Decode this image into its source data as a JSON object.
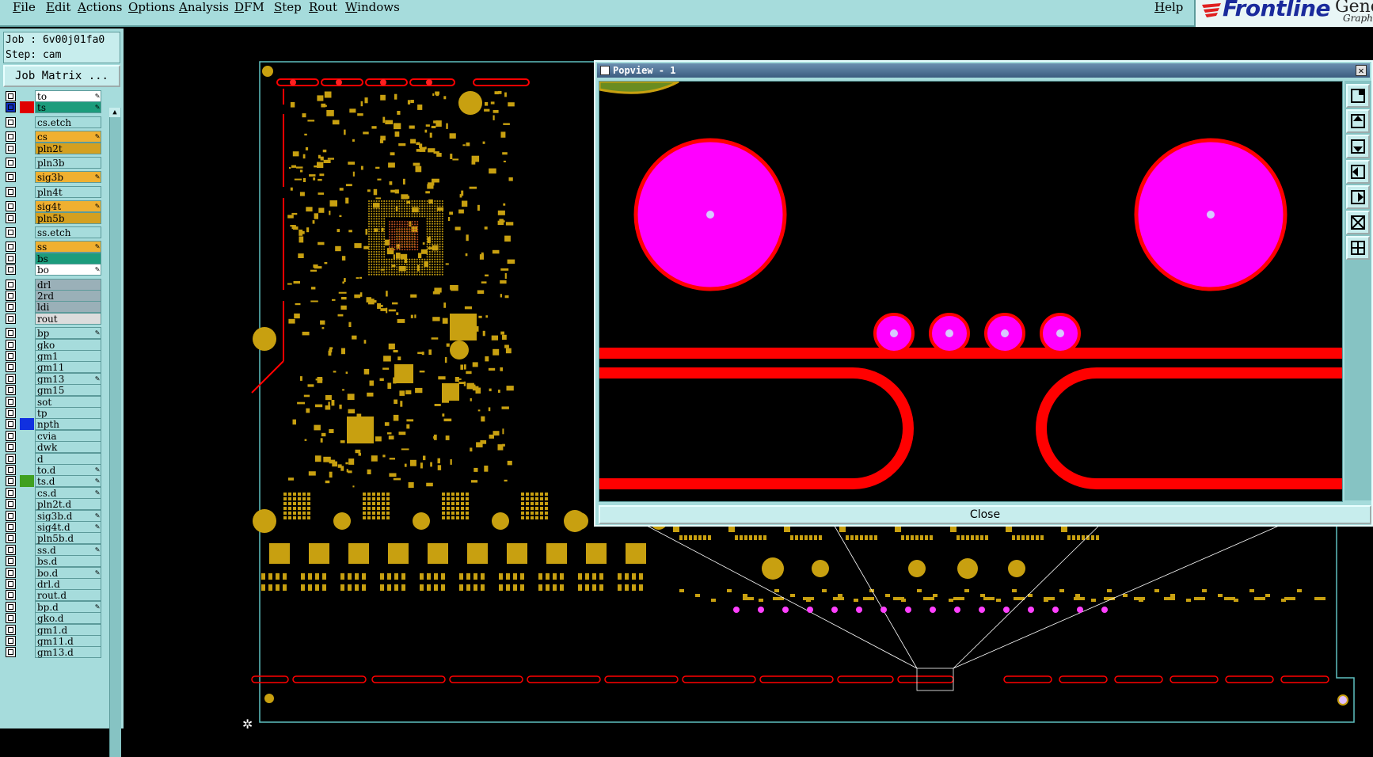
{
  "menubar": {
    "items": [
      "File",
      "Edit",
      "Actions",
      "Options",
      "Analysis",
      "DFM",
      "Step",
      "Rout",
      "Windows"
    ],
    "help": "Help"
  },
  "logo": {
    "brand": "Frontline",
    "tail": "Gene",
    "sub": "Graph"
  },
  "job": {
    "job_label": "Job : 6v00j01fa0",
    "step_label": "Step: cam",
    "matrix_button": "Job Matrix ..."
  },
  "layers": [
    {
      "name": "to",
      "bg": "#ffffff",
      "swatch": "",
      "mark": "✎"
    },
    {
      "name": "ts",
      "bg": "#1c9c7c",
      "swatch": "#e00000",
      "mark": "✎",
      "active": true
    },
    {
      "name": "cs.etch",
      "bg": "#a6dcdc",
      "swatch": "",
      "mark": "",
      "gap": true
    },
    {
      "name": "cs",
      "bg": "#f0b030",
      "swatch": "",
      "mark": "✎",
      "gap": true
    },
    {
      "name": "pln2t",
      "bg": "#d4a020",
      "swatch": "",
      "mark": ""
    },
    {
      "name": "pln3b",
      "bg": "#a6dcdc",
      "swatch": "",
      "mark": "",
      "gap": true
    },
    {
      "name": "sig3b",
      "bg": "#f0b030",
      "swatch": "",
      "mark": "✎",
      "gap": true
    },
    {
      "name": "pln4t",
      "bg": "#a6dcdc",
      "swatch": "",
      "mark": "",
      "gap": true
    },
    {
      "name": "sig4t",
      "bg": "#f0b030",
      "swatch": "",
      "mark": "✎",
      "gap": true
    },
    {
      "name": "pln5b",
      "bg": "#d4a020",
      "swatch": "",
      "mark": ""
    },
    {
      "name": "ss.etch",
      "bg": "#a6dcdc",
      "swatch": "",
      "mark": "",
      "gap": true
    },
    {
      "name": "ss",
      "bg": "#f0b030",
      "swatch": "",
      "mark": "✎",
      "gap": true
    },
    {
      "name": "bs",
      "bg": "#1c9c7c",
      "swatch": "",
      "mark": ""
    },
    {
      "name": "bo",
      "bg": "#ffffff",
      "swatch": "",
      "mark": "✎"
    },
    {
      "name": "drl",
      "bg": "#9ab0b8",
      "swatch": "",
      "mark": "",
      "gap": true
    },
    {
      "name": "2rd",
      "bg": "#9ab0b8",
      "swatch": "",
      "mark": ""
    },
    {
      "name": "ldi",
      "bg": "#9ab0b8",
      "swatch": "",
      "mark": ""
    },
    {
      "name": "rout",
      "bg": "#dcdcdc",
      "swatch": "",
      "mark": ""
    },
    {
      "name": "bp",
      "bg": "#a6dcdc",
      "swatch": "",
      "mark": "✎",
      "gap": true
    },
    {
      "name": "gko",
      "bg": "#a6dcdc",
      "swatch": "",
      "mark": ""
    },
    {
      "name": "gm1",
      "bg": "#a6dcdc",
      "swatch": "",
      "mark": ""
    },
    {
      "name": "gm11",
      "bg": "#a6dcdc",
      "swatch": "",
      "mark": ""
    },
    {
      "name": "gm13",
      "bg": "#a6dcdc",
      "swatch": "",
      "mark": "✎"
    },
    {
      "name": "gm15",
      "bg": "#a6dcdc",
      "swatch": "",
      "mark": ""
    },
    {
      "name": "sot",
      "bg": "#a6dcdc",
      "swatch": "",
      "mark": ""
    },
    {
      "name": "tp",
      "bg": "#a6dcdc",
      "swatch": "",
      "mark": ""
    },
    {
      "name": "npth",
      "bg": "#a6dcdc",
      "swatch": "#1030e0",
      "mark": ""
    },
    {
      "name": "cvia",
      "bg": "#a6dcdc",
      "swatch": "",
      "mark": ""
    },
    {
      "name": "dwk",
      "bg": "#a6dcdc",
      "swatch": "",
      "mark": ""
    },
    {
      "name": "d",
      "bg": "#a6dcdc",
      "swatch": "",
      "mark": ""
    },
    {
      "name": "to.d",
      "bg": "#a6dcdc",
      "swatch": "",
      "mark": "✎"
    },
    {
      "name": "ts.d",
      "bg": "#a6dcdc",
      "swatch": "#40a020",
      "mark": "✎"
    },
    {
      "name": "cs.d",
      "bg": "#a6dcdc",
      "swatch": "",
      "mark": "✎"
    },
    {
      "name": "pln2t.d",
      "bg": "#a6dcdc",
      "swatch": "",
      "mark": ""
    },
    {
      "name": "sig3b.d",
      "bg": "#a6dcdc",
      "swatch": "",
      "mark": "✎"
    },
    {
      "name": "sig4t.d",
      "bg": "#a6dcdc",
      "swatch": "",
      "mark": "✎"
    },
    {
      "name": "pln5b.d",
      "bg": "#a6dcdc",
      "swatch": "",
      "mark": ""
    },
    {
      "name": "ss.d",
      "bg": "#a6dcdc",
      "swatch": "",
      "mark": "✎"
    },
    {
      "name": "bs.d",
      "bg": "#a6dcdc",
      "swatch": "",
      "mark": ""
    },
    {
      "name": "bo.d",
      "bg": "#a6dcdc",
      "swatch": "",
      "mark": "✎"
    },
    {
      "name": "drl.d",
      "bg": "#a6dcdc",
      "swatch": "",
      "mark": ""
    },
    {
      "name": "rout.d",
      "bg": "#a6dcdc",
      "swatch": "",
      "mark": ""
    },
    {
      "name": "bp.d",
      "bg": "#a6dcdc",
      "swatch": "",
      "mark": "✎"
    },
    {
      "name": "gko.d",
      "bg": "#a6dcdc",
      "swatch": "",
      "mark": ""
    },
    {
      "name": "gm1.d",
      "bg": "#a6dcdc",
      "swatch": "",
      "mark": ""
    },
    {
      "name": "gm11.d",
      "bg": "#a6dcdc",
      "swatch": "",
      "mark": ""
    },
    {
      "name": "gm13.d",
      "bg": "#a6dcdc",
      "swatch": "",
      "mark": ""
    }
  ],
  "popview": {
    "title": "Popview - 1",
    "close_x": "✕",
    "close_button": "Close",
    "tools": [
      "zoom-window-icon",
      "pan-up-icon",
      "pan-down-icon",
      "pan-left-icon",
      "pan-right-icon",
      "zoom-fit-icon",
      "zoom-home-icon"
    ]
  },
  "colors": {
    "panel": "#a6dcdc",
    "pad_magenta": "#ff00ff",
    "trace_red": "#ff0000",
    "copper_gold": "#c8a010",
    "outline_cyan": "#5fc0c0"
  }
}
